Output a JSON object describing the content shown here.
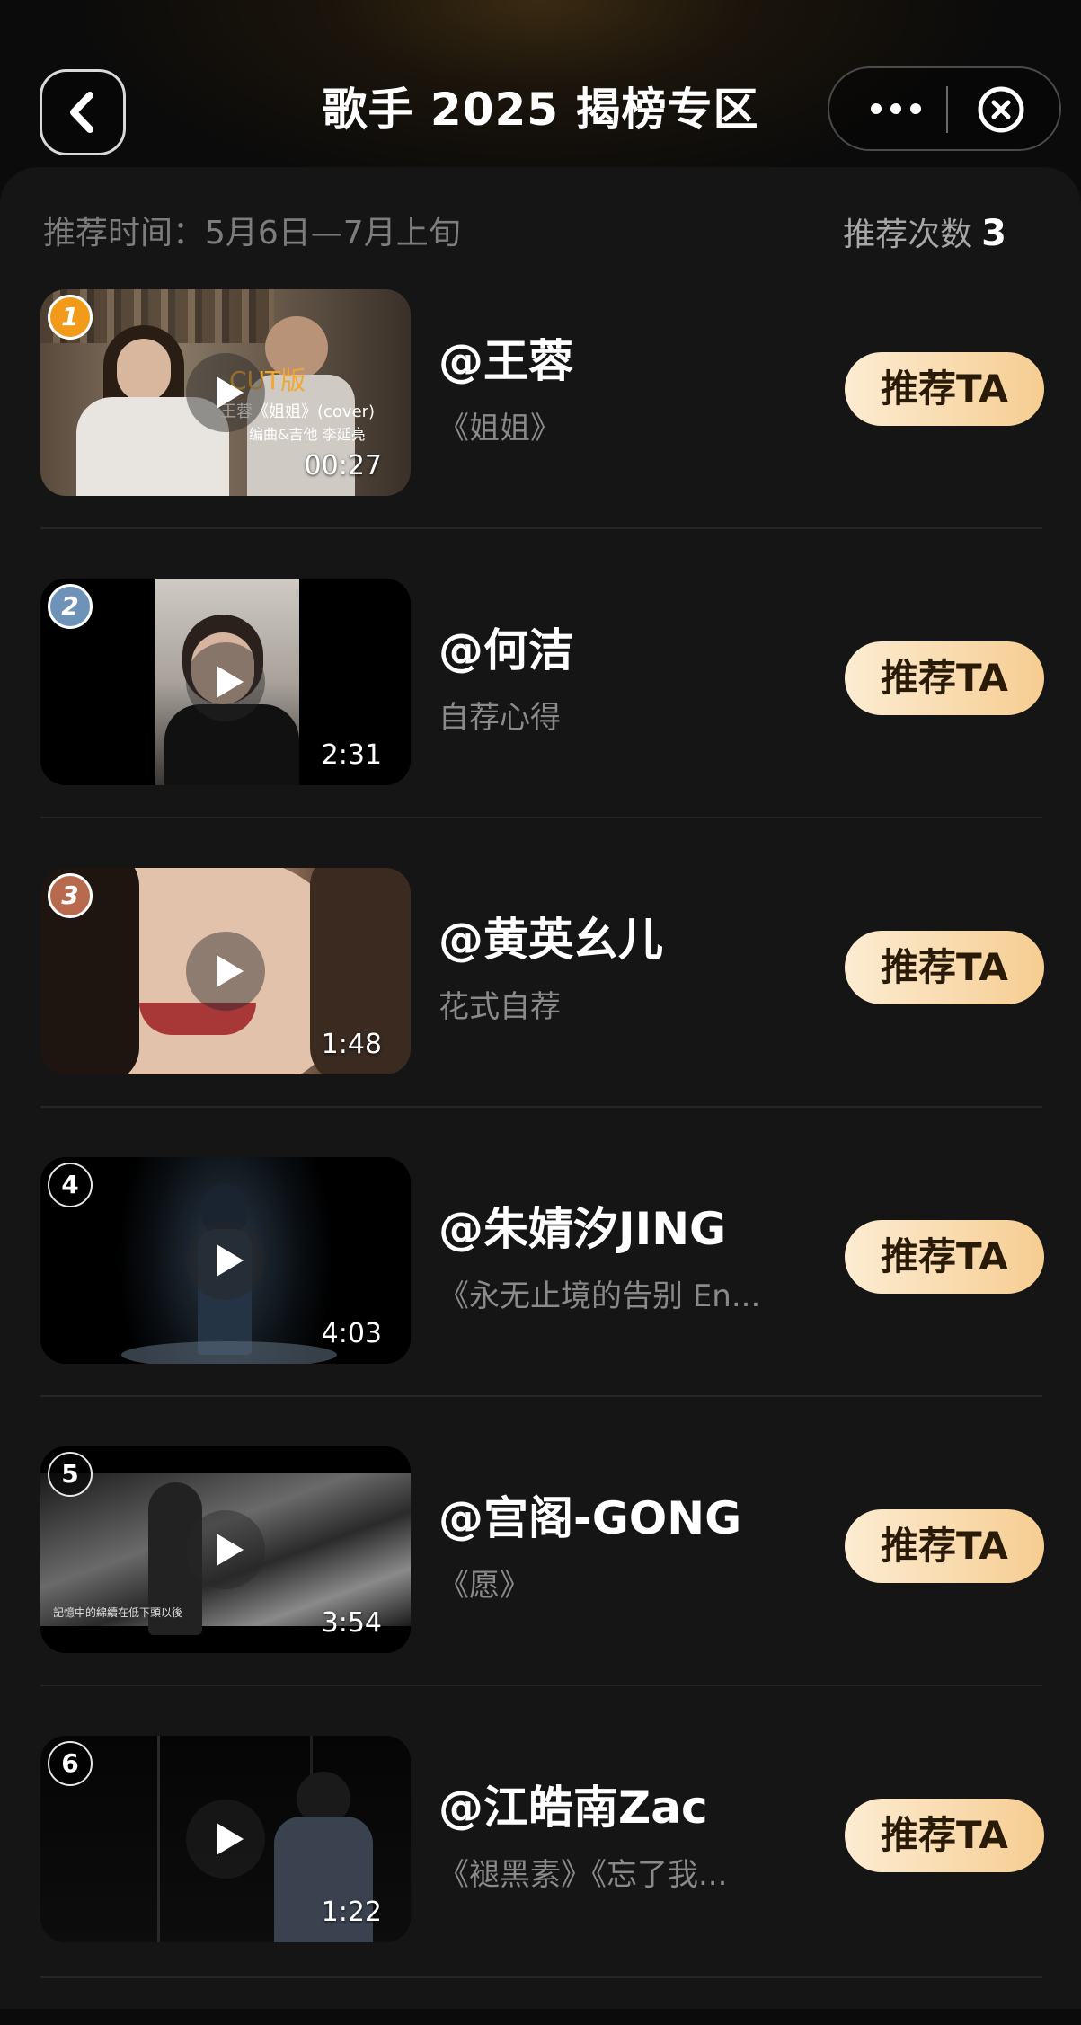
{
  "header": {
    "title": "歌手 2025 揭榜专区",
    "back_icon": "chevron-left-icon",
    "more_icon": "more-dots-icon",
    "close_icon": "close-circle-icon"
  },
  "info": {
    "period": "推荐时间：5月6日—7月上旬",
    "count_label": "推荐次数",
    "count_value": "3"
  },
  "colors": {
    "cta_gradient_start": "#fcecd2",
    "cta_gradient_end": "#f6cd91",
    "rank1": "#f29b1b",
    "rank2": "#6f93b8",
    "rank3": "#b86a4f"
  },
  "items": [
    {
      "rank": "1",
      "name": "@王蓉",
      "subtitle": "《姐姐》",
      "duration": "00:27",
      "cta": "推荐TA",
      "thumb_text_1": "CUT版",
      "thumb_text_2": "王蓉《姐姐》(cover)",
      "thumb_text_3": "编曲&吉他  李延亮"
    },
    {
      "rank": "2",
      "name": "@何洁",
      "subtitle": "自荐心得",
      "duration": "2:31",
      "cta": "推荐TA"
    },
    {
      "rank": "3",
      "name": "@黄英幺儿",
      "subtitle": "花式自荐",
      "duration": "1:48",
      "cta": "推荐TA"
    },
    {
      "rank": "4",
      "name": "@朱婧汐JING",
      "subtitle": "《永无止境的告别 En...",
      "duration": "4:03",
      "cta": "推荐TA"
    },
    {
      "rank": "5",
      "name": "@宫阁-GONG",
      "subtitle": "《愿》",
      "duration": "3:54",
      "cta": "推荐TA",
      "thumb_caption": "記憶中的綿續在低下頭以後"
    },
    {
      "rank": "6",
      "name": "@江皓南Zac",
      "subtitle": "《褪黑素》《忘了我...",
      "duration": "1:22",
      "cta": "推荐TA"
    }
  ]
}
